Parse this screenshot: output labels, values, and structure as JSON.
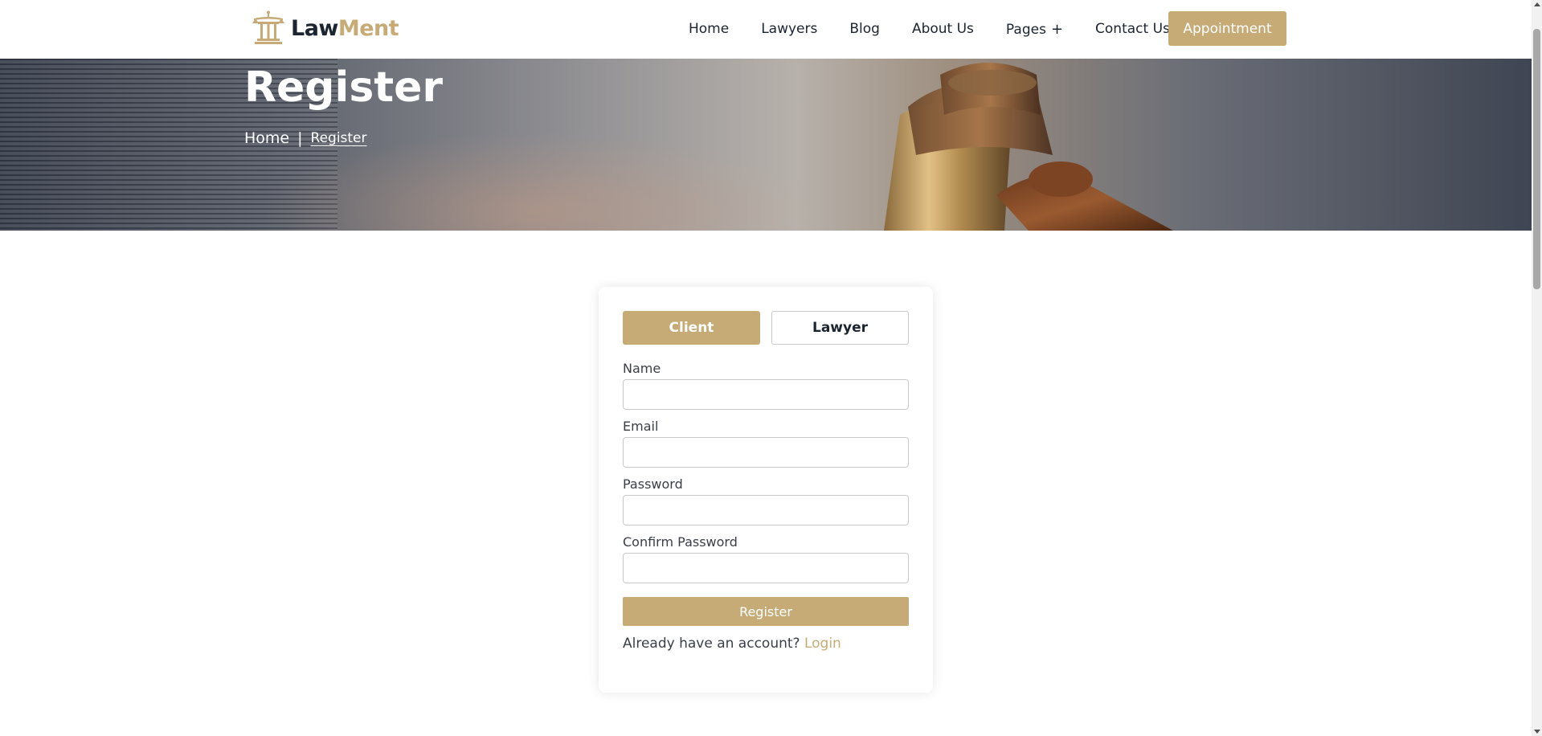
{
  "colors": {
    "accent": "#c6ab76",
    "text_dark": "#1b2430",
    "white": "#ffffff"
  },
  "header": {
    "logo": {
      "icon": "scales-pillar-icon",
      "text_dark": "Law",
      "text_gold": "Ment"
    },
    "nav": [
      {
        "label": "Home"
      },
      {
        "label": "Lawyers"
      },
      {
        "label": "Blog"
      },
      {
        "label": "About Us"
      },
      {
        "label": "Pages",
        "suffix": "+"
      },
      {
        "label": "Contact Us"
      }
    ],
    "cta_label": "Appointment"
  },
  "hero": {
    "title": "Register",
    "breadcrumb": {
      "home": "Home",
      "separator": "|",
      "current": "Register"
    }
  },
  "form": {
    "tabs": {
      "client": "Client",
      "lawyer": "Lawyer",
      "active": "client"
    },
    "fields": {
      "name": {
        "label": "Name",
        "value": "",
        "placeholder": ""
      },
      "email": {
        "label": "Email",
        "value": "",
        "placeholder": ""
      },
      "password": {
        "label": "Password",
        "value": "",
        "placeholder": ""
      },
      "confirm_password": {
        "label": "Confirm Password",
        "value": "",
        "placeholder": ""
      }
    },
    "submit_label": "Register",
    "login_prompt": "Already have an account?",
    "login_link": "Login"
  }
}
